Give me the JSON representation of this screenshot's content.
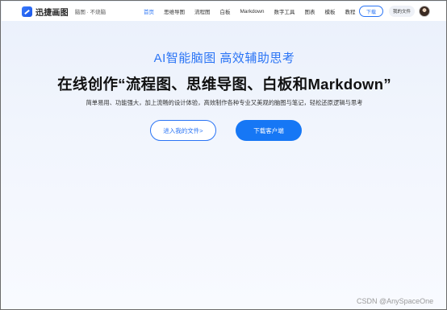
{
  "header": {
    "logo_name": "迅捷画图",
    "logo_tagline": "脑图 · 不烧脑",
    "menu": [
      {
        "label": "首页",
        "active": true
      },
      {
        "label": "思维导图",
        "active": false
      },
      {
        "label": "流程图",
        "active": false
      },
      {
        "label": "白板",
        "active": false
      },
      {
        "label": "Markdown",
        "active": false
      },
      {
        "label": "数字工具",
        "active": false
      },
      {
        "label": "图表",
        "active": false
      },
      {
        "label": "模板",
        "active": false
      },
      {
        "label": "教程",
        "active": false
      }
    ],
    "download_label": "下载",
    "my_files_label": "我的文件"
  },
  "hero": {
    "subtitle": "AI智能脑图  高效辅助思考",
    "title": "在线创作“流程图、思维导图、白板和Markdown”",
    "description": "简单易用、功能强大，加上流畅的设计体验，高效制作各种专业又美观的脑图与笔记，轻松还原逻辑与思考",
    "enter_files_label": "进入我的文件>",
    "download_client_label": "下载客户端"
  },
  "watermark": "CSDN @AnySpaceOne",
  "colors": {
    "accent": "#2a74f5",
    "primary_button": "#1677f5"
  }
}
